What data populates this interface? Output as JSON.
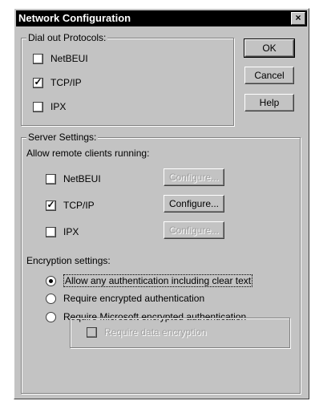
{
  "window": {
    "title": "Network Configuration",
    "close_glyph": "×"
  },
  "buttons": {
    "ok": "OK",
    "cancel": "Cancel",
    "help": "Help"
  },
  "dialout": {
    "legend": "Dial out Protocols:",
    "items": [
      {
        "label": "NetBEUI",
        "checked": false
      },
      {
        "label": "TCP/IP",
        "checked": true
      },
      {
        "label": "IPX",
        "checked": false
      }
    ]
  },
  "server": {
    "legend": "Server Settings:",
    "allow_label": "Allow remote clients running:",
    "items": [
      {
        "label": "NetBEUI",
        "checked": false,
        "configure": "Configure...",
        "configure_enabled": false
      },
      {
        "label": "TCP/IP",
        "checked": true,
        "configure": "Configure...",
        "configure_enabled": true
      },
      {
        "label": "IPX",
        "checked": false,
        "configure": "Configure...",
        "configure_enabled": false
      }
    ],
    "encryption_label": "Encryption settings:",
    "encryption_options": [
      {
        "label": "Allow any authentication including clear text",
        "selected": true
      },
      {
        "label": "Require encrypted authentication",
        "selected": false
      },
      {
        "label": "Require Microsoft encrypted authentication",
        "selected": false
      }
    ],
    "data_encryption": {
      "label": "Require data encryption",
      "checked": false,
      "enabled": false
    }
  }
}
